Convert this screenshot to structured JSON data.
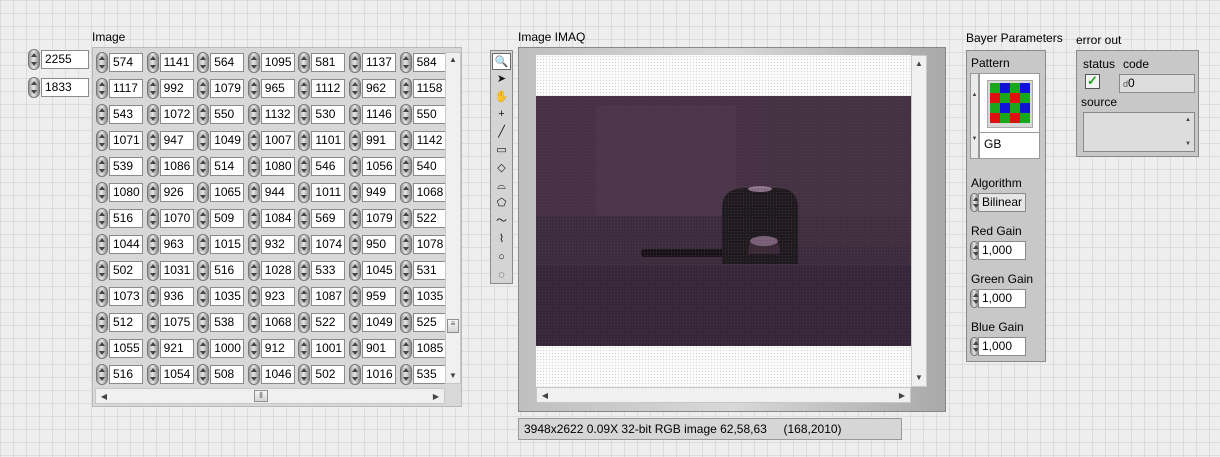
{
  "array": {
    "label": "Image",
    "index_row": "2255",
    "index_col": "1833",
    "rows": [
      [
        "574",
        "1141",
        "564",
        "1095",
        "581",
        "1137",
        "584"
      ],
      [
        "1117",
        "992",
        "1079",
        "965",
        "1112",
        "962",
        "1158"
      ],
      [
        "543",
        "1072",
        "550",
        "1132",
        "530",
        "1146",
        "550"
      ],
      [
        "1071",
        "947",
        "1049",
        "1007",
        "1101",
        "991",
        "1142"
      ],
      [
        "539",
        "1086",
        "514",
        "1080",
        "546",
        "1056",
        "540"
      ],
      [
        "1080",
        "926",
        "1065",
        "944",
        "1011",
        "949",
        "1068"
      ],
      [
        "516",
        "1070",
        "509",
        "1084",
        "569",
        "1079",
        "522"
      ],
      [
        "1044",
        "963",
        "1015",
        "932",
        "1074",
        "950",
        "1078"
      ],
      [
        "502",
        "1031",
        "516",
        "1028",
        "533",
        "1045",
        "531"
      ],
      [
        "1073",
        "936",
        "1035",
        "923",
        "1087",
        "959",
        "1035"
      ],
      [
        "512",
        "1075",
        "538",
        "1068",
        "522",
        "1049",
        "525"
      ],
      [
        "1055",
        "921",
        "1000",
        "912",
        "1001",
        "901",
        "1085"
      ],
      [
        "516",
        "1054",
        "508",
        "1046",
        "502",
        "1016",
        "535"
      ]
    ]
  },
  "imaq": {
    "label": "Image IMAQ",
    "status": "3948x2622 0.09X 32-bit RGB image 62,58,63     (168,2010)",
    "tools": [
      "zoom-tool-icon",
      "pointer-tool-icon",
      "pan-hand-icon",
      "point-tool-icon",
      "line-tool-icon",
      "rectangle-tool-icon",
      "rotated-rectangle-tool-icon",
      "annulus-tool-icon",
      "polygon-tool-icon",
      "freehand-tool-icon",
      "broken-line-tool-icon",
      "oval-tool-icon",
      "freehand-region-tool-icon"
    ]
  },
  "bayer": {
    "label": "Bayer Parameters",
    "pattern_label": "Pattern",
    "pattern_value": "GB",
    "algorithm_label": "Algorithm",
    "algorithm_value": "Bilinear",
    "red_gain_label": "Red Gain",
    "red_gain_value": "1,000",
    "green_gain_label": "Green Gain",
    "green_gain_value": "1,000",
    "blue_gain_label": "Blue Gain",
    "blue_gain_value": "1,000",
    "colors": {
      "green": "#1aa81a",
      "red": "#e01010",
      "blue": "#1010d8"
    }
  },
  "error": {
    "label": "error out",
    "status_label": "status",
    "code_label": "code",
    "code_value": "0",
    "code_prefix": "d",
    "source_label": "source",
    "status_ok_color": "#20a020"
  }
}
